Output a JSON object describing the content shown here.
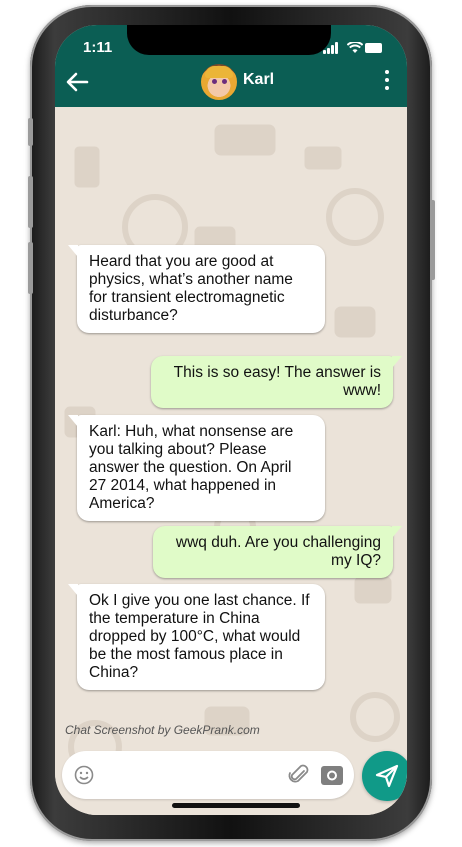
{
  "status_bar": {
    "time": "1:11"
  },
  "header": {
    "contact_name": "Karl"
  },
  "messages": [
    {
      "direction": "incoming",
      "text": "Heard that you are good at physics, what’s another name for transient electromagnetic disturbance?"
    },
    {
      "direction": "outgoing",
      "text": "This is so easy! The answer is www!"
    },
    {
      "direction": "incoming",
      "text": "Karl: Huh, what nonsense are you talking about? Please answer the question. On April 27 2014, what happened in America?"
    },
    {
      "direction": "outgoing",
      "text": "wwq duh. Are you challenging my IQ?"
    },
    {
      "direction": "incoming",
      "text": "Ok I give you one last chance. If the temperature in China dropped by 100°C, what would be the most famous place in China?"
    }
  ],
  "watermark": "Chat Screenshot by GeekPrank.com",
  "composer": {
    "value": "",
    "placeholder": ""
  },
  "icons": {
    "back": "arrow-left-icon",
    "menu": "more-vertical-icon",
    "emoji": "emoji-icon",
    "attach": "paperclip-icon",
    "camera": "camera-icon",
    "send": "send-icon"
  },
  "colors": {
    "header": "#0b5e54",
    "wallpaper": "#ebe3d9",
    "outgoing_bubble": "#e0fbc8",
    "incoming_bubble": "#ffffff",
    "send_button": "#109a88"
  }
}
